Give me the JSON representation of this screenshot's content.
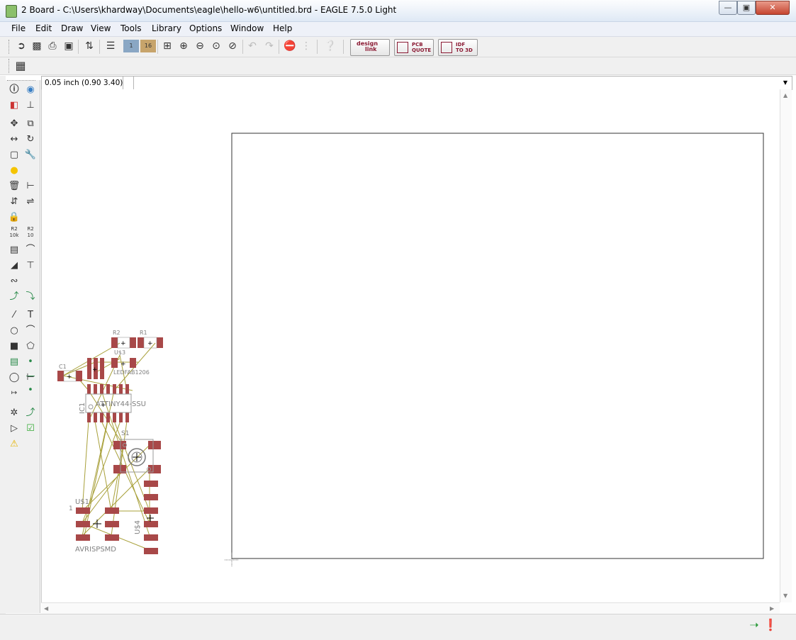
{
  "window": {
    "title": "2 Board - C:\\Users\\khardway\\Documents\\eagle\\hello-w6\\untitled.brd - EAGLE 7.5.0 Light",
    "minimize": "0",
    "maximize": "1",
    "close": "r"
  },
  "menu": [
    "File",
    "Edit",
    "Draw",
    "View",
    "Tools",
    "Library",
    "Options",
    "Window",
    "Help"
  ],
  "toolbar": {
    "designlink_line1": "design",
    "designlink_line2": "link",
    "pcbquote_line1": "PCB",
    "pcbquote_line2": "QUOTE",
    "idf_line1": "IDF",
    "idf_line2": "TO 3D",
    "layer1": "1",
    "layer2": "16"
  },
  "command_line": {
    "coordinates": "0.05 inch (0.90 3.40)",
    "value": ""
  },
  "left_tools": {
    "r2_label": "R2",
    "r2_value": "10k",
    "r2b_label": "R2",
    "r2b_value": "10"
  },
  "parts": {
    "r2": "R2",
    "r1": "R1",
    "c1": "C1",
    "led_name": "U$3",
    "led_value": "LEDFAB1206",
    "ic_name": "IC1",
    "ic_value": "ATTINY44-SSU",
    "switch_name": "S1",
    "isp_name": "U$1",
    "isp_pin1": "1",
    "isp_value": "AVRISPSMD",
    "header_name": "U$4"
  },
  "colors": {
    "pad": "#a84848",
    "airwire": "#a8a03a",
    "outline": "#333333",
    "label": "#808080"
  }
}
